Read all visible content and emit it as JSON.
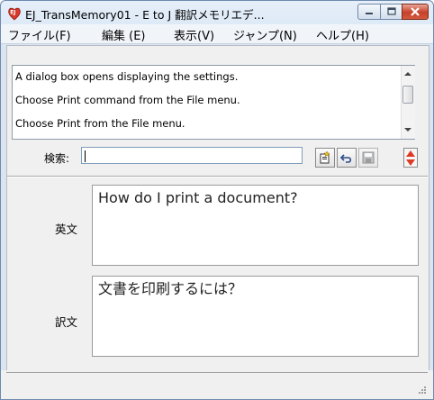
{
  "window": {
    "title": "EJ_TransMemory01 - E to J 翻訳メモリエデ..."
  },
  "menu": [
    {
      "label": "ファイル(F)"
    },
    {
      "label": "編集 (E)"
    },
    {
      "label": "表示(V)"
    },
    {
      "label": "ジャンプ(N)"
    },
    {
      "label": "ヘルプ(H)"
    }
  ],
  "results_list": [
    {
      "text": "A dialog box opens displaying the settings."
    },
    {
      "text": "Choose Print command from the File menu."
    },
    {
      "text": "Choose Print from the File menu."
    }
  ],
  "search": {
    "label": "検索:",
    "value": ""
  },
  "toolbar": {
    "icons": [
      "new-entry-icon",
      "undo-icon",
      "save-icon",
      "spin-updown-icon"
    ]
  },
  "english": {
    "label": "英文",
    "text": "How do I print a document?"
  },
  "translation": {
    "label": "訳文",
    "text": "文書を印刷するには？"
  },
  "colors": {
    "close_button": "#c7402a",
    "spin_arrow": "#e03a24",
    "title_gradient_top": "#e6eff9"
  }
}
